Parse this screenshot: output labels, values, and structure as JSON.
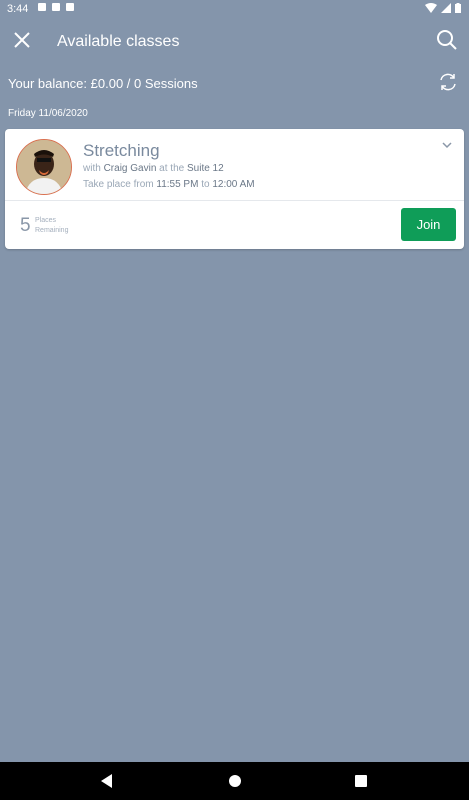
{
  "status_bar": {
    "time": "3:44"
  },
  "app_bar": {
    "title": "Available classes",
    "close_icon": "close-icon",
    "search_icon": "search-icon"
  },
  "balance": {
    "text": "Your balance: £0.00 / 0 Sessions",
    "refresh_icon": "refresh-icon"
  },
  "date_label": "Friday 11/06/2020",
  "class_card": {
    "name": "Stretching",
    "with_prefix": "with",
    "instructor": "Craig Gavin",
    "at_the": "at the",
    "location": "Suite 12",
    "time_prefix": "Take place from",
    "start_time": "11:55 PM",
    "to": "to",
    "end_time": "12:00 AM",
    "places_count": "5",
    "places_label_1": "Places",
    "places_label_2": "Remaining",
    "join_label": "Join",
    "join_color": "#0f9d58"
  },
  "colors": {
    "background": "#8495ab",
    "card": "#ffffff"
  }
}
